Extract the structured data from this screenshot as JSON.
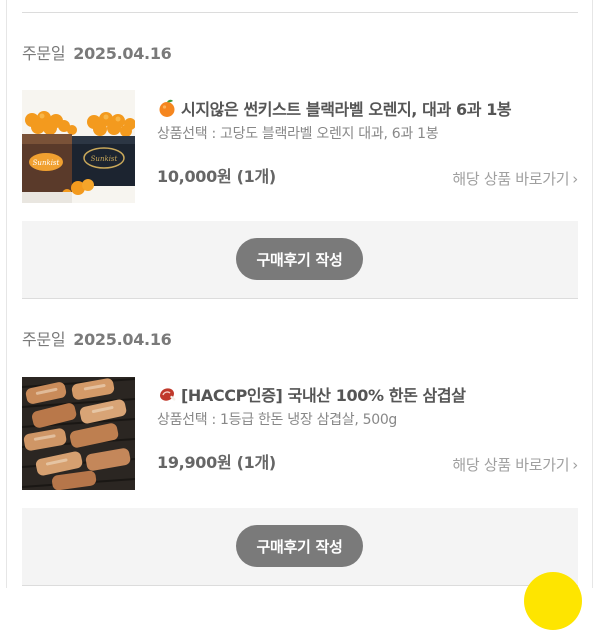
{
  "orders": [
    {
      "order_date_label": "주문일",
      "order_date": "2025.04.16",
      "product_icon": "orange-emoji-icon",
      "product_name": "시지않은 썬키스트 블랙라벨 오렌지, 대과 6과 1봉",
      "option": "상품선택 : 고당도 블랙라벨 오렌지 대과, 6과 1봉",
      "price": "10,000원 (1개)",
      "goto_label": "해당 상품 바로가기",
      "review_button": "구매후기 작성",
      "thumb_labels": [
        "Sunkist",
        "Sunkist"
      ]
    },
    {
      "order_date_label": "주문일",
      "order_date": "2025.04.16",
      "product_icon": "meat-emoji-icon",
      "product_name": "[HACCP인증] 국내산 100% 한돈 삼겹살",
      "option": "상품선택 : 1등급 한돈 냉장 삼겹살, 500g",
      "price": "19,900원 (1개)",
      "goto_label": "해당 상품 바로가기",
      "review_button": "구매후기 작성"
    }
  ],
  "colors": {
    "review_button_bg": "#7a7a7a",
    "panel_bg": "#f4f4f4",
    "fab_yellow": "#fee500"
  }
}
